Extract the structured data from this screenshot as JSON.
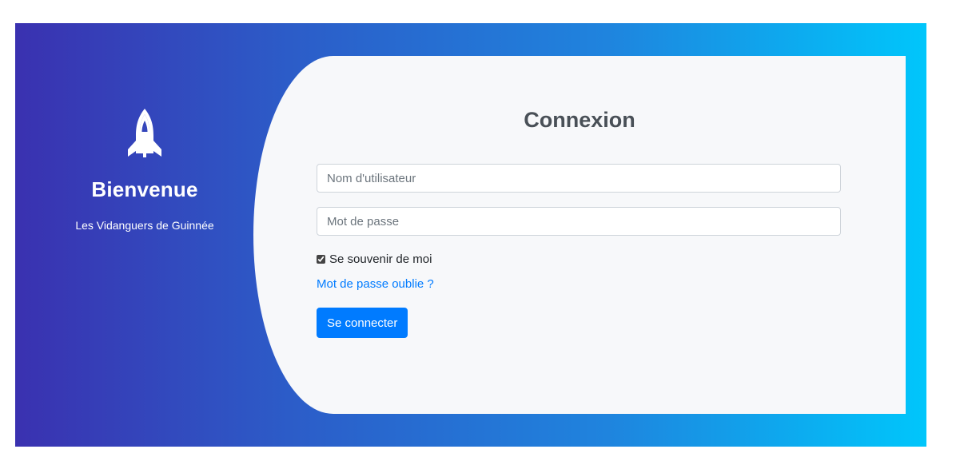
{
  "brand_panel": {
    "icon": "rocket-icon",
    "welcome": "Bienvenue",
    "subtitle": "Les Vidanguers de Guinnée"
  },
  "login_form": {
    "title": "Connexion",
    "username_placeholder": "Nom d'utilisateur",
    "username_value": "",
    "password_placeholder": "Mot de passe",
    "password_value": "",
    "remember_label": "Se souvenir de moi",
    "remember_checked": true,
    "forgot_link": "Mot de passe oublie ?",
    "submit_label": "Se connecter"
  },
  "colors": {
    "gradient_start": "#3a31b0",
    "gradient_end": "#00c6fb",
    "card_background": "#f7f8fa",
    "primary_button": "#007bff",
    "link": "#007bff"
  }
}
